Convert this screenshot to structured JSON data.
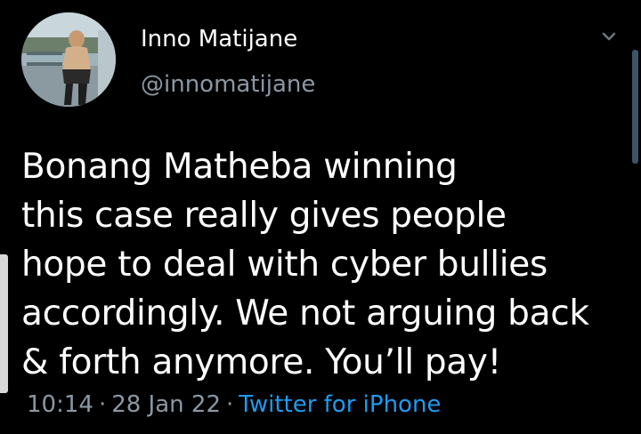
{
  "author": {
    "display_name": "Inno Matijane",
    "handle": "@innomatijane"
  },
  "tweet": {
    "lines": [
      "Bonang Matheba winning",
      "this case really gives people",
      "hope to deal with cyber bullies",
      "accordingly. We not arguing back",
      "& forth anymore. You’ll pay!"
    ]
  },
  "meta": {
    "time": "10:14",
    "date": "28 Jan 22",
    "separator": "·",
    "source": "Twitter for iPhone"
  },
  "colors": {
    "background": "#000000",
    "text": "#ffffff",
    "secondary": "#8b98a5",
    "link": "#1d9bf0"
  },
  "icons": {
    "more": "chevron-down-icon"
  }
}
